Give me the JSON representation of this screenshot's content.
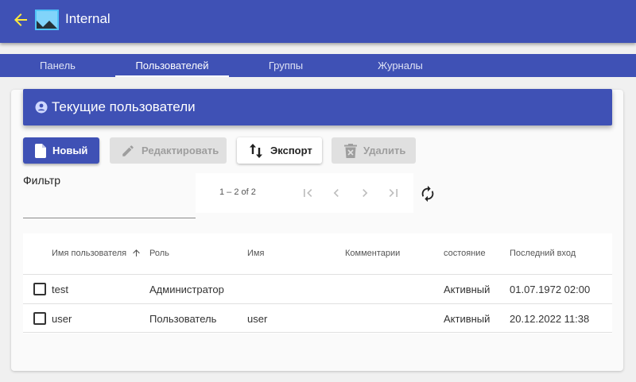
{
  "app": {
    "title": "Internal",
    "back_icon": "arrow-left-icon",
    "logo_icon": "image-icon",
    "accent": "#3f51b5",
    "back_color": "#ffeb3b"
  },
  "tabs": [
    {
      "label": "Панель",
      "active": false
    },
    {
      "label": "Пользователей",
      "active": true
    },
    {
      "label": "Группы",
      "active": false
    },
    {
      "label": "Журналы",
      "active": false
    }
  ],
  "section": {
    "title": "Текущие пользователи",
    "icon": "account-circle-icon"
  },
  "toolbar": {
    "new_label": "Новый",
    "edit_label": "Редактировать",
    "export_label": "Экспорт",
    "delete_label": "Удалить"
  },
  "filter": {
    "label": "Фильтр",
    "value": "",
    "placeholder": ""
  },
  "paginator": {
    "range": "1 – 2 of 2"
  },
  "table": {
    "columns": [
      "Имя пользователя",
      "Роль",
      "Имя",
      "Комментарии",
      "состояние",
      "Последний вход"
    ],
    "sort": {
      "column": "Имя пользователя",
      "direction": "asc"
    },
    "rows": [
      {
        "username": "test",
        "role": "Администратор",
        "name": "",
        "comments": "",
        "status": "Активный",
        "last_login": "01.07.1972 02:00",
        "checked": false
      },
      {
        "username": "user",
        "role": "Пользователь",
        "name": "user",
        "comments": "",
        "status": "Активный",
        "last_login": "20.12.2022 11:38",
        "checked": false
      }
    ]
  }
}
